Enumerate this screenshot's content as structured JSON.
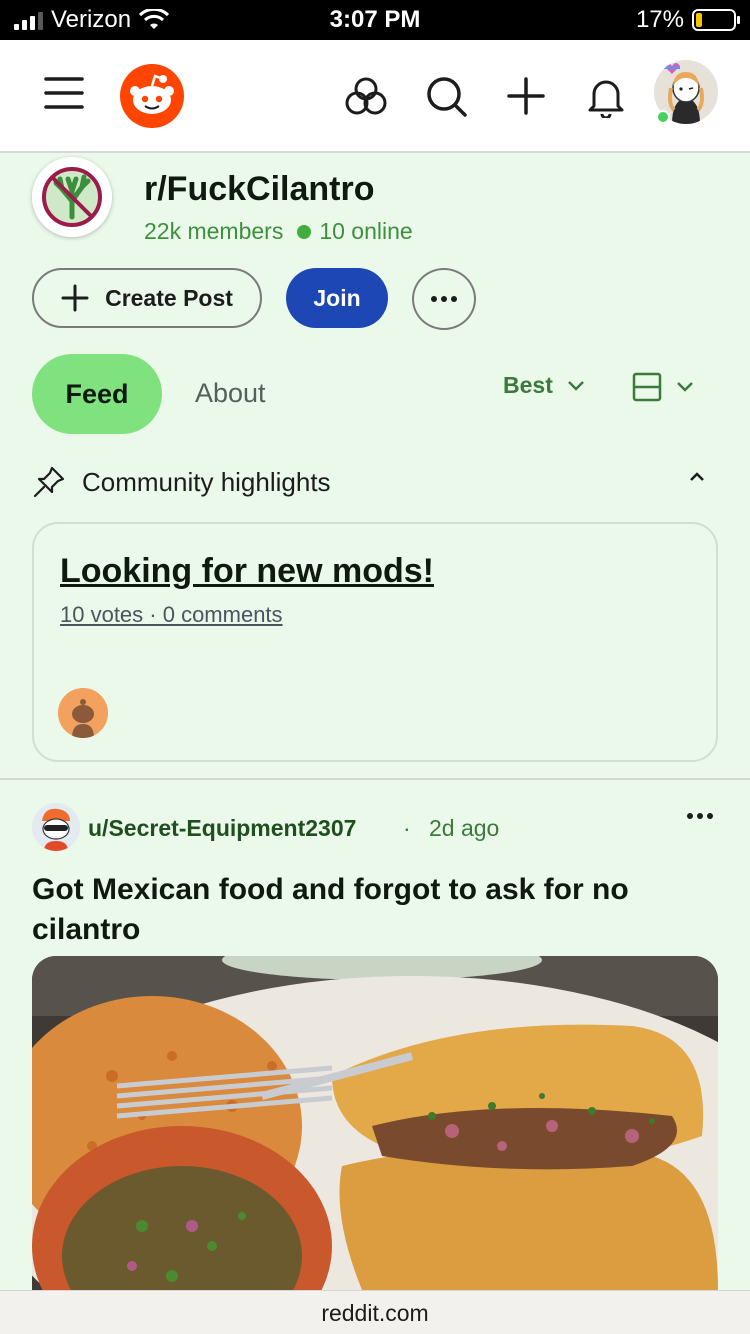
{
  "status_bar": {
    "carrier": "Verizon",
    "time": "3:07 PM",
    "battery": "17%"
  },
  "app_header": {
    "icons": [
      "menu-icon",
      "reddit-logo",
      "explore-icon",
      "search-icon",
      "plus-icon",
      "bell-icon",
      "user-avatar"
    ]
  },
  "community": {
    "name": "r/FuckCilantro",
    "members": "22k members",
    "online": "10 online",
    "create_post_label": "Create Post",
    "join_label": "Join"
  },
  "tabs": {
    "feed": "Feed",
    "about": "About",
    "sort": "Best"
  },
  "highlights": {
    "label": "Community highlights",
    "card_title": "Looking for new mods!",
    "card_meta": "10 votes · 0 comments"
  },
  "post": {
    "user": "u/Secret-Equipment2307",
    "separator": "·",
    "time": "2d ago",
    "title": "Got Mexican food and forgot to ask for no cilantro"
  },
  "browser": {
    "url": "reddit.com"
  },
  "colors": {
    "background": "#eaf9ea",
    "reddit_orange": "#ff4500",
    "join_blue": "#1d47b4",
    "feed_green": "#7fe27f",
    "meta_green": "#3f8f3f"
  }
}
